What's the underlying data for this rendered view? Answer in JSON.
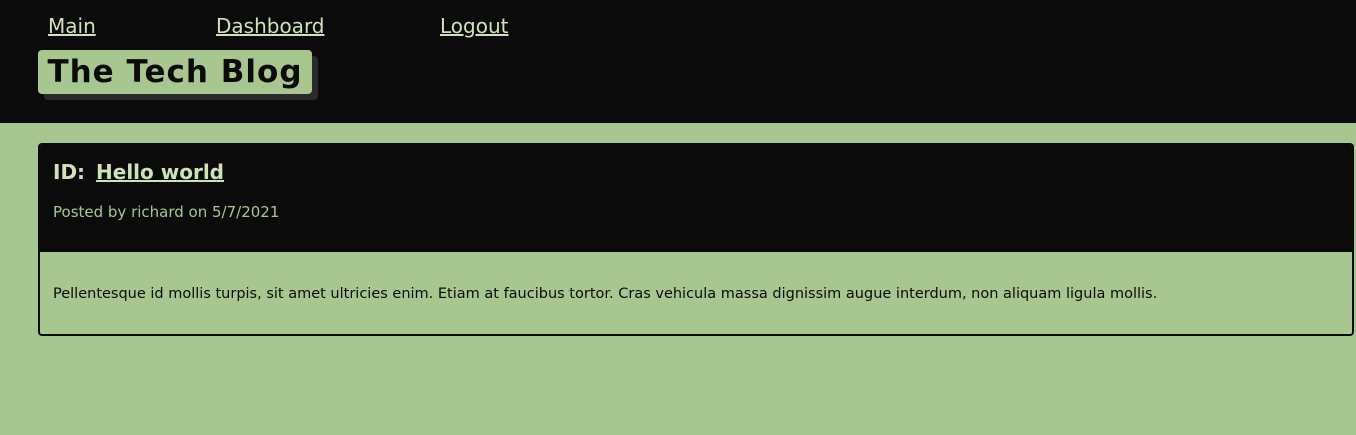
{
  "nav": {
    "main_label": "Main",
    "dashboard_label": "Dashboard",
    "logout_label": "Logout"
  },
  "brand": {
    "title": "The Tech Blog"
  },
  "post": {
    "id_prefix": "ID:",
    "title": "Hello world",
    "meta": "Posted by richard on 5/7/2021",
    "body": "Pellentesque id mollis turpis, sit amet ultricies enim. Etiam at faucibus tortor. Cras vehicula massa dignissim augue interdum, non aliquam ligula mollis."
  },
  "colors": {
    "background": "#a8c68f",
    "header": "#0c0b0b",
    "link": "#cfe2b8"
  }
}
